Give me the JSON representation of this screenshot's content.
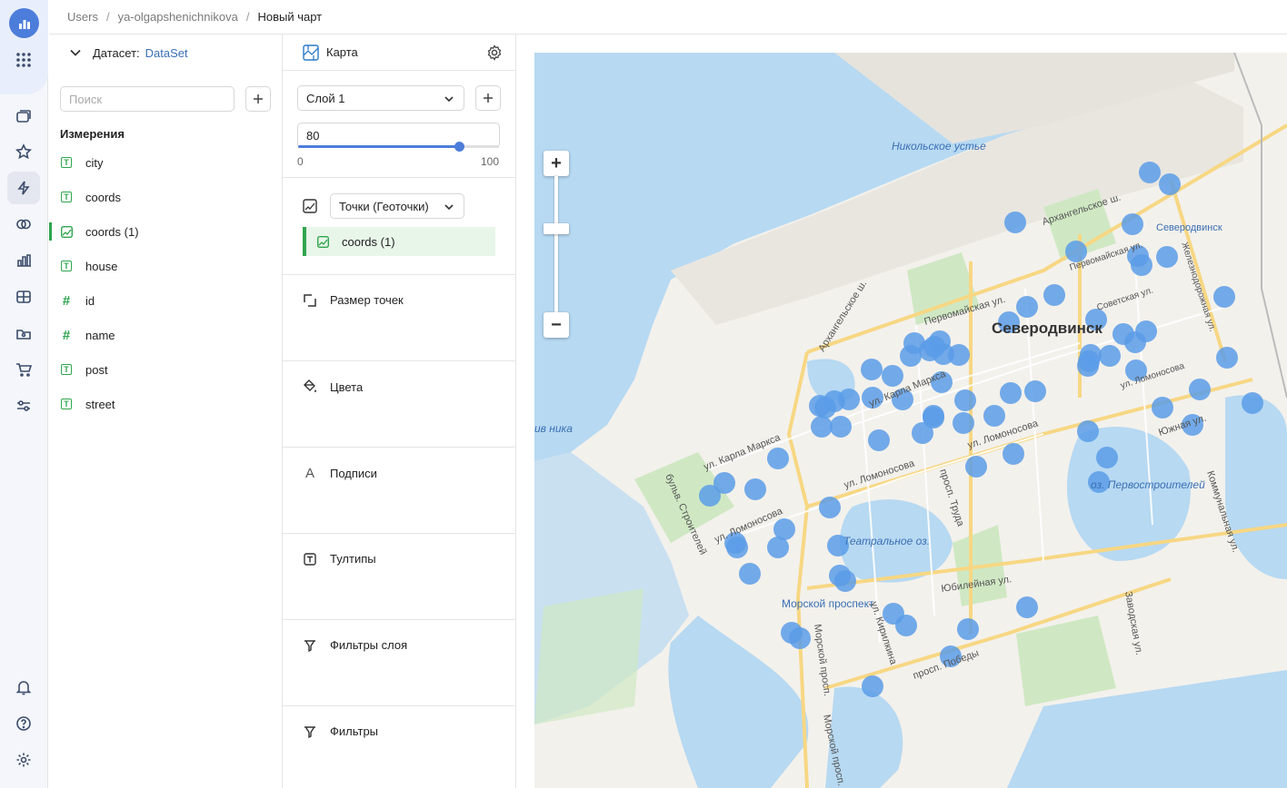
{
  "breadcrumbs": [
    "Users",
    "ya-olgapshenichnikova",
    "Новый чарт"
  ],
  "dataset": {
    "label": "Датасет:",
    "name": "DataSet",
    "search_placeholder": "Поиск",
    "section_title": "Измерения",
    "fields": [
      {
        "name": "city",
        "type": "text"
      },
      {
        "name": "coords",
        "type": "text"
      },
      {
        "name": "coords (1)",
        "type": "geo",
        "selected": true
      },
      {
        "name": "house",
        "type": "text"
      },
      {
        "name": "id",
        "type": "number"
      },
      {
        "name": "name",
        "type": "number"
      },
      {
        "name": "post",
        "type": "text"
      },
      {
        "name": "street",
        "type": "text"
      }
    ]
  },
  "config": {
    "chart_type": "Карта",
    "layer": "Слой 1",
    "opacity": 80,
    "opacity_min": "0",
    "opacity_max": "100",
    "geo_type": "Точки (Геоточки)",
    "geo_field": "coords (1)",
    "sections": [
      "Размер точек",
      "Цвета",
      "Подписи",
      "Тултипы",
      "Фильтры слоя",
      "Фильтры"
    ]
  },
  "map": {
    "labels": [
      "Никольское устье",
      "Северодвинск",
      "Северодвинск",
      "Архангельское ш.",
      "Первомайская ул.",
      "Первомайская ул.",
      "Советская ул.",
      "Железнодорожная ул.",
      "ул. Карла Маркса",
      "ул. Карла Маркса",
      "ул. Ломоносова",
      "ул. Ломоносова",
      "ул. Ломоносова",
      "ул. Ломоносова",
      "Южная ул.",
      "оз. Первостроителей",
      "Театральное оз.",
      "просп. Труда",
      "Морской проспект",
      "Морской просп.",
      "Юбилейная ул.",
      "просп. Победы",
      "ул. Кирилкина",
      "бульв. Строителей",
      "Коммунальная ул.",
      "Заводская ул.",
      "Морской просп.",
      "Архангельское ш.",
      "ив ника"
    ],
    "point_color": "#5b9ce8",
    "points": 70
  },
  "rail_icons": [
    "charts-logo",
    "apps-icon",
    "collections-icon",
    "favorites-icon",
    "charts-icon",
    "connections-icon",
    "dashboards-icon",
    "datasets-icon",
    "reports-icon",
    "marketplace-icon",
    "settings-sliders-icon",
    "notifications-icon",
    "help-icon",
    "settings-icon"
  ]
}
